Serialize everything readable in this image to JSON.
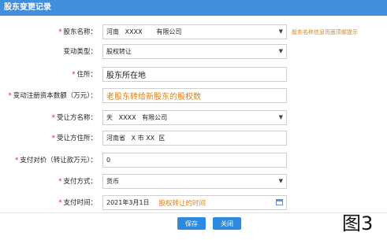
{
  "window": {
    "title": "股东变更记录"
  },
  "form": {
    "shareholder_name": {
      "label": "股东名称：",
      "value": "河南   XXXX       有限公司",
      "hint": "股东名称信息页面顶部提示"
    },
    "change_type": {
      "label": "变动类型：",
      "value": "股权转让"
    },
    "address": {
      "label": "住所：",
      "value": "股东所在地"
    },
    "change_amount": {
      "label": "变动注册资本数额（万元）：",
      "placeholder": "老股东转给新股东的股权数"
    },
    "transferee_name": {
      "label": "受让方名称：",
      "value": "天   XXXX   有限公司"
    },
    "transferee_address": {
      "label": "受让方住所：",
      "value": "河南省   X 市 XX  区"
    },
    "payment_amount": {
      "label": "支付对价（转让款万元）：",
      "value": "0"
    },
    "payment_method": {
      "label": "支付方式：",
      "value": "货币"
    },
    "payment_time": {
      "label": "支付时间：",
      "value": "2021年3月1日",
      "hint": "股权转让的时间"
    }
  },
  "buttons": {
    "save": "保存",
    "close": "关闭"
  },
  "figure_label": "图3",
  "colors": {
    "header": "#3f8fda",
    "button": "#2d8ae0",
    "required": "#e02020",
    "hint": "#d2841c"
  }
}
